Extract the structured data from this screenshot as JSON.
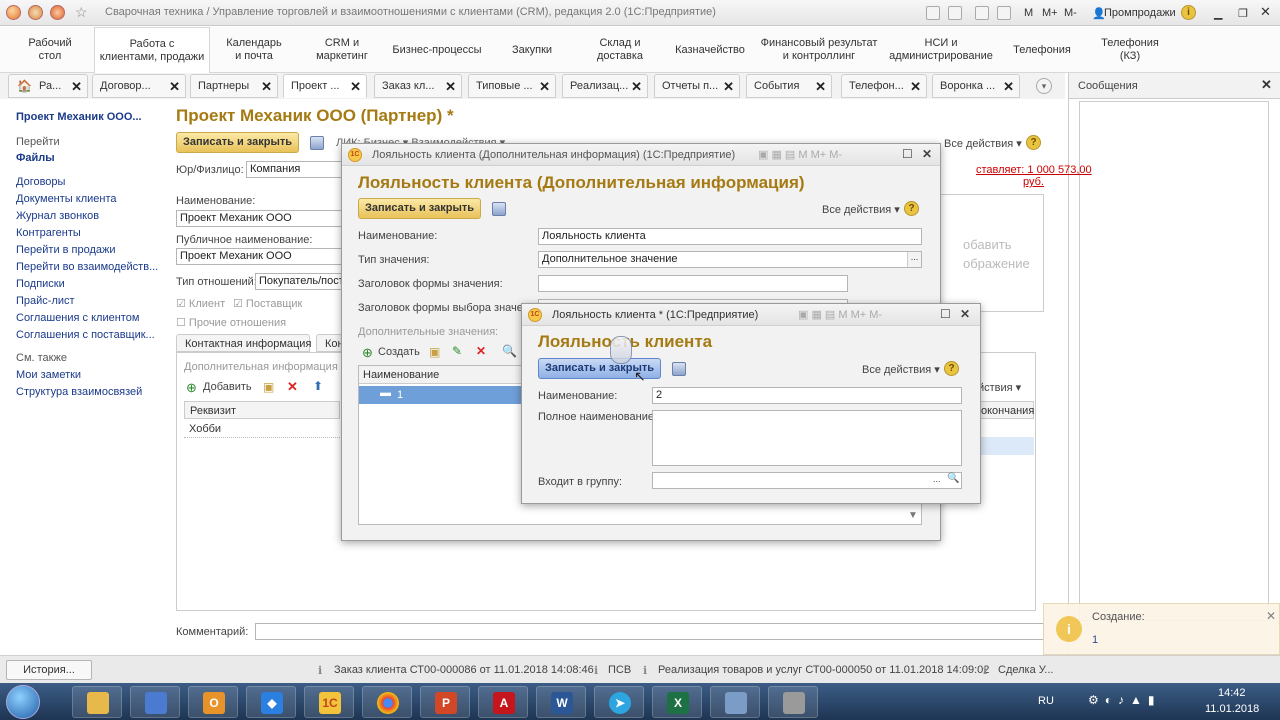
{
  "titlebar": {
    "title": "Сварочная техника / Управление торговлей и взаимоотношениями с клиентами (CRM), редакция 2.0  (1С:Предприятие)",
    "m": "M",
    "mplus": "M+",
    "mminus": "M-",
    "user": "Промпродажи"
  },
  "sections": [
    "Рабочий\nстол",
    "Работа с\nклиентами, продажи",
    "Календарь\nи почта",
    "CRM и\nмаркетинг",
    "Бизнес-процессы",
    "Закупки",
    "Склад и\nдоставка",
    "Казначейство",
    "Финансовый результат\nи контроллинг",
    "НСИ и\nадминистрирование",
    "Телефония",
    "Телефония\n(КЗ)"
  ],
  "tabs": [
    "Ра...",
    "Договор...",
    "Партнеры",
    "Проект ...",
    "Заказ кл...",
    "Типовые ...",
    "Реализац...",
    "Отчеты п...",
    "События",
    "Телефон...",
    "Воронка ..."
  ],
  "messages": {
    "title": "Сообщения"
  },
  "leftnav": {
    "title": "Проект Механик ООО...",
    "goto": "Перейти",
    "files": "Файлы",
    "items": [
      "Договоры",
      "Документы клиента",
      "Журнал звонков",
      "Контрагенты",
      "Перейти в продажи",
      "Перейти во взаимодейств...",
      "Подписки",
      "Прайс-лист",
      "Соглашения с клиентом",
      "Соглашения с поставщик..."
    ],
    "seealso": "См. также",
    "seeitems": [
      "Мои заметки",
      "Структура взаимосвязей"
    ]
  },
  "partner": {
    "title": "Проект Механик ООО (Партнер) *",
    "save_close": "Записать и закрыть",
    "toolbar_cut": "ЛИК: Бизнес ▾   Взаимодействия ▾",
    "all_actions": "Все действия ▾",
    "legal_label": "Юр/Физлицо:",
    "legal_value": "Компания",
    "name_label": "Наименование:",
    "name_value": "Проект Механик ООО",
    "public_label": "Публичное наименование:",
    "public_value": "Проект Механик ООО",
    "relation_label": "Тип отношений:",
    "relation_value": "Покупатель/пост",
    "client": "Клиент",
    "supplier": "Поставщик",
    "other": "Прочие отношения",
    "debt": "ставляет: 1 000 573,00",
    "debt2": "руб.",
    "tab_contact": "Контактная информация",
    "tab_cut": "Кон",
    "addinfo": "Дополнительная информация",
    "add": "Добавить",
    "col_req": "Реквизит",
    "row_hobby": "Хобби",
    "right_actions": "йствия ▾",
    "right_col": "окончания",
    "photo1": "обавить",
    "photo2": "ображение",
    "comment_label": "Комментарий:"
  },
  "loyalty": {
    "wintitle": "Лояльность клиента (Дополнительная информация)  (1С:Предприятие)",
    "title": "Лояльность клиента (Дополнительная информация)",
    "save_close": "Записать и закрыть",
    "all_actions": "Все действия ▾",
    "name_label": "Наименование:",
    "name_value": "Лояльность клиента",
    "type_label": "Тип значения:",
    "type_value": "Дополнительное значение",
    "form_label": "Заголовок формы значения:",
    "choice_label": "Заголовок формы выбора значени",
    "values_label": "Дополнительные значения:",
    "create": "Создать",
    "col_name": "Наименование",
    "row1": "1"
  },
  "value": {
    "wintitle": "Лояльность клиента *  (1С:Предприятие)",
    "title": "Лояльность клиента",
    "save_close": "Записать и закрыть",
    "all_actions": "Все действия ▾",
    "name_label": "Наименование:",
    "name_value": "2",
    "full_label": "Полное наименование:",
    "group_label": "Входит в группу:"
  },
  "notify": {
    "title": "Создание:",
    "link": "1"
  },
  "bottom": {
    "history": "История...",
    "n1": "Заказ клиента СТ00-000086 от 11.01.2018 14:08:46",
    "n2": "ПСВ",
    "n3": "Реализация товаров и услуг СТ00-000050 от 11.01.2018 14:09:02",
    "n4": "Сделка У..."
  },
  "taskbar": {
    "lang": "RU",
    "time": "14:42",
    "date": "11.01.2018"
  }
}
